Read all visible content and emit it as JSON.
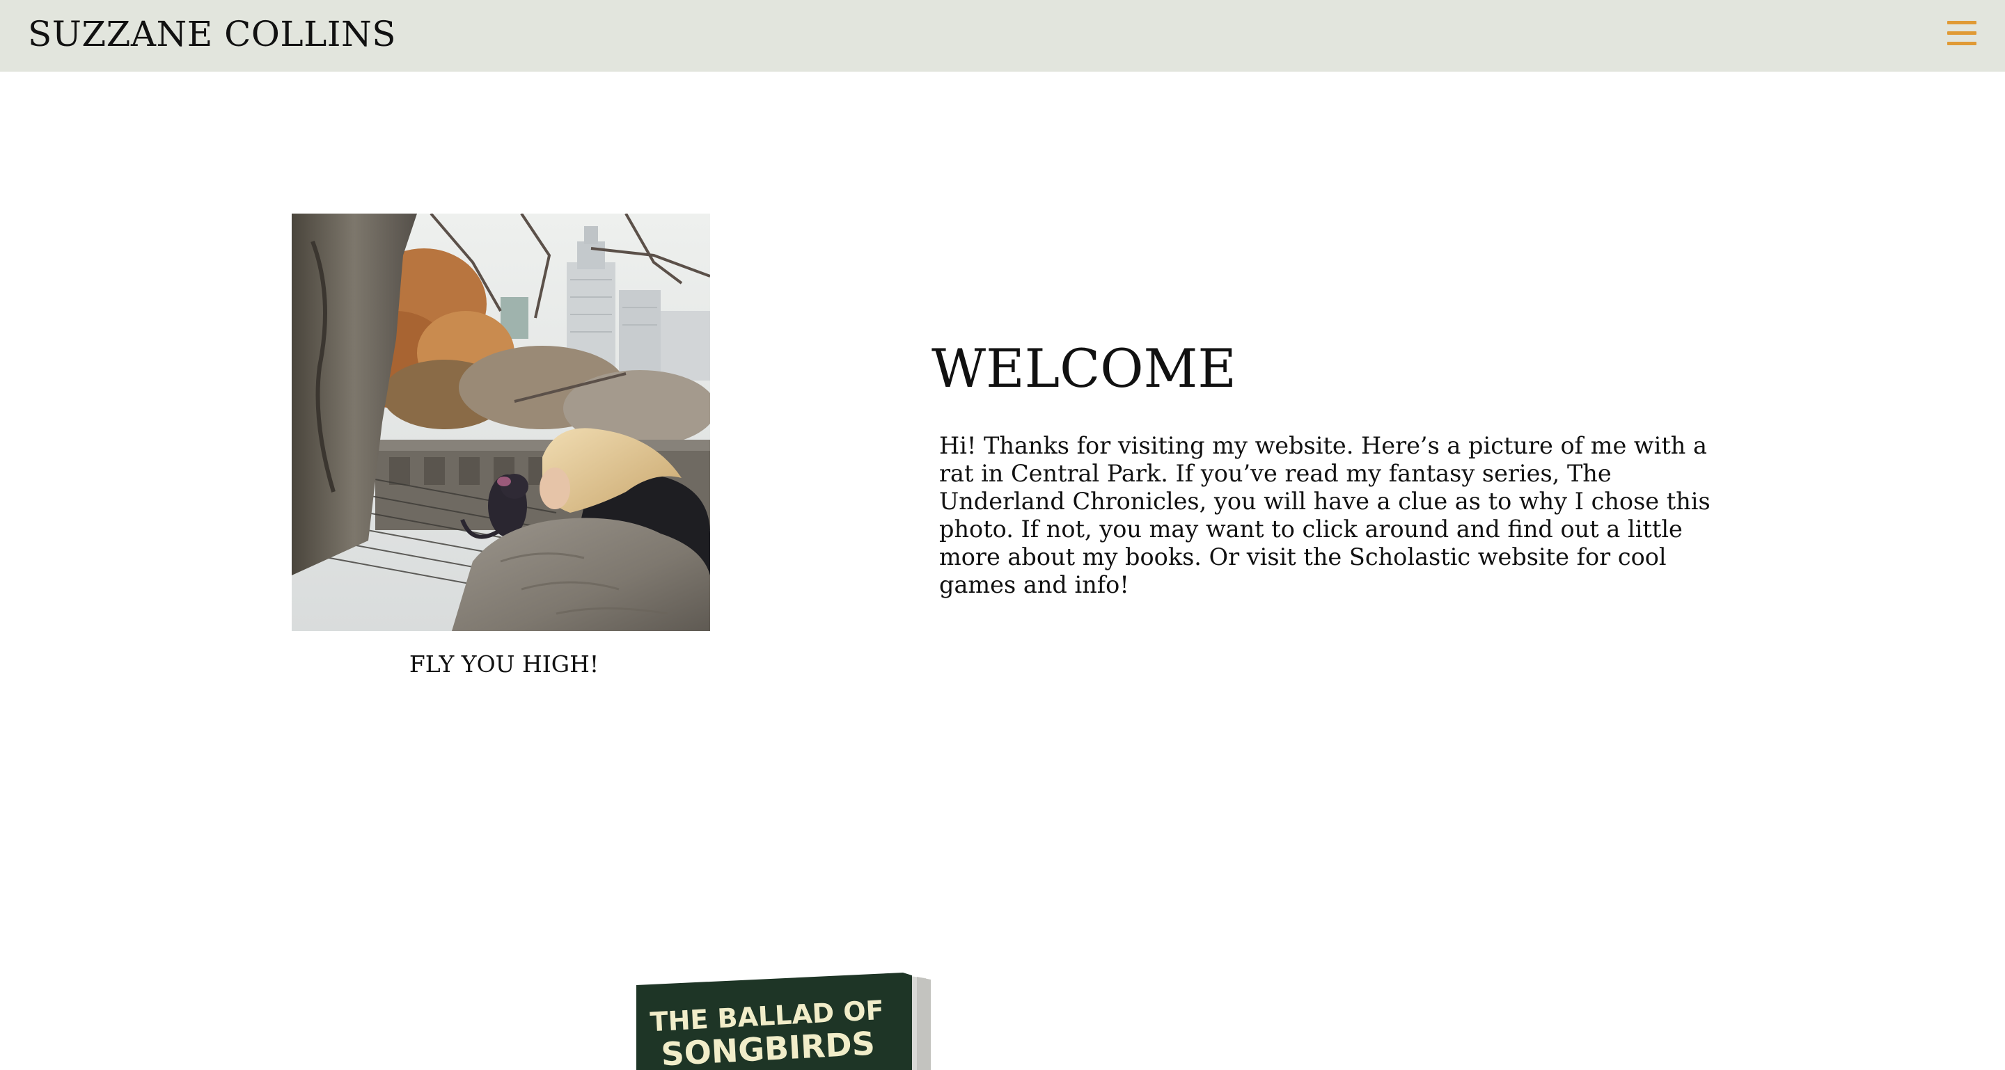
{
  "header": {
    "site_title": "SUZZANE COLLINS",
    "menu_icon": "hamburger-menu-icon",
    "menu_icon_color": "#e09a35",
    "background_color": "#e2e5dd"
  },
  "intro": {
    "photo_alt": "Suzanne Collins with a rat in Central Park",
    "caption": "FLY YOU HIGH!",
    "heading": "WELCOME",
    "paragraph": "Hi! Thanks for visiting my website. Here’s a picture of me with a rat in Central Park. If you’ve read my fantasy series, The Underland Chronicles, you will have a clue as to why I chose this photo. If not, you may want to click around and find out a little more about my books. Or visit the Scholastic website for cool games and info!"
  },
  "featured_book": {
    "title_line1": "THE BALLAD OF",
    "title_line2": "SONGBIRDS",
    "cover_color": "#1e3526",
    "title_color": "#f1edc9"
  }
}
